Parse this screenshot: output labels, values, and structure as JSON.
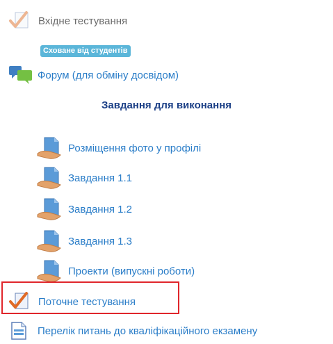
{
  "items": {
    "entry_test": "Вхідне тестування",
    "hidden_badge": "Сховане від студентів",
    "forum": "Форум (для обміну досвідом)",
    "section_title": "Завдання для виконання",
    "assign_photo": "Розміщення фото у профілі",
    "assign_1_1": "Завдання 1.1",
    "assign_1_2": "Завдання 1.2",
    "assign_1_3": "Завдання 1.3",
    "projects": "Проекти (випускні роботи)",
    "current_test": "Поточне тестування",
    "exam_list": "Перелік питань до кваліфікаційного екзамену"
  },
  "icons": {
    "entry_test": "quiz-checkmark-icon",
    "forum": "forum-icon",
    "assignment": "assignment-icon",
    "current_test": "quiz-checkmark-icon",
    "exam_list": "file-icon"
  },
  "colors": {
    "link": "#2a7dc8",
    "muted": "#6b6b6b",
    "badge": "#5bb6d9",
    "section": "#1b3f86",
    "highlight": "#e0262b"
  }
}
